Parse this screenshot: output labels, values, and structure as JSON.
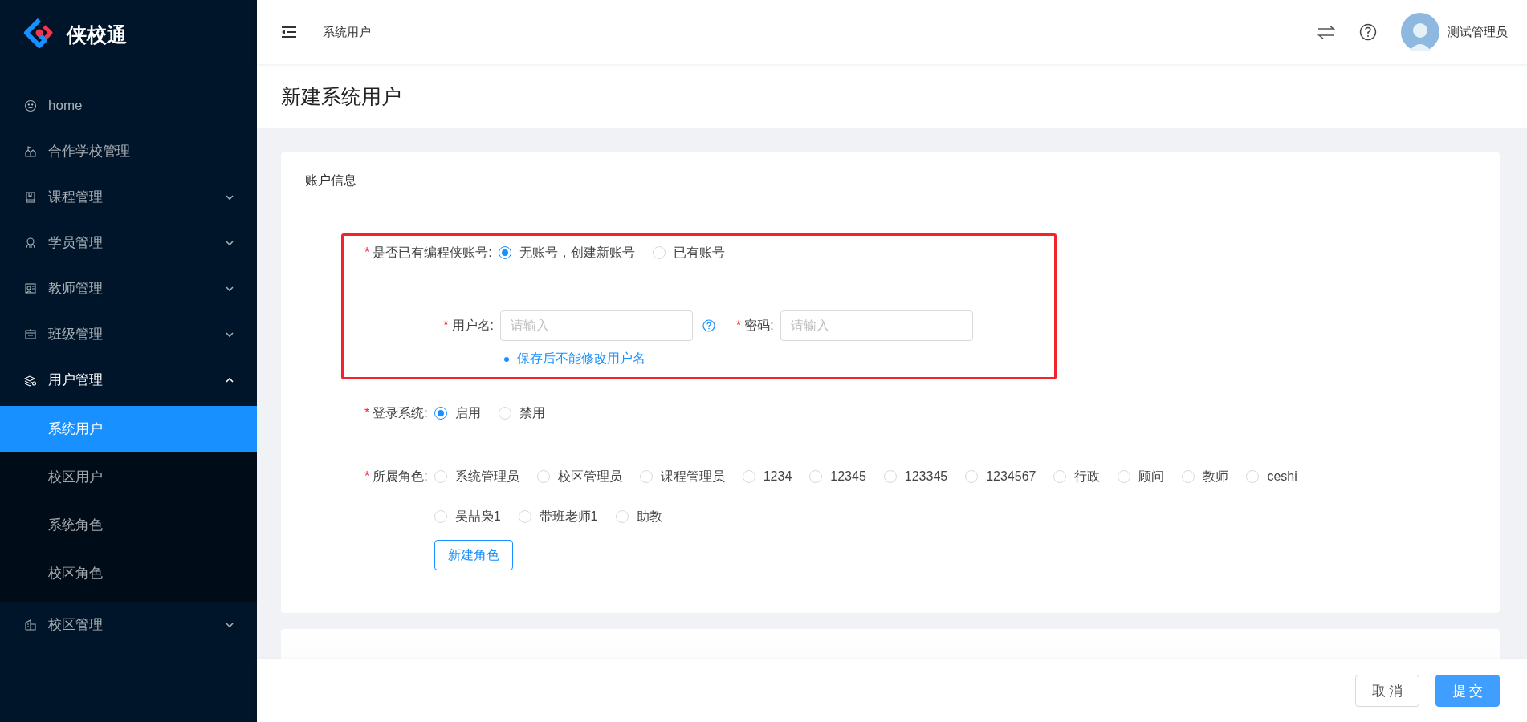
{
  "brand": {
    "name": "侠校通"
  },
  "sidebar": {
    "items": [
      {
        "label": "home"
      },
      {
        "label": "合作学校管理"
      },
      {
        "label": "课程管理",
        "expanded": false
      },
      {
        "label": "学员管理",
        "expanded": false
      },
      {
        "label": "教师管理",
        "expanded": false
      },
      {
        "label": "班级管理",
        "expanded": false
      },
      {
        "label": "用户管理",
        "expanded": true,
        "children": [
          {
            "label": "系统用户",
            "selected": true
          },
          {
            "label": "校区用户",
            "selected": false
          },
          {
            "label": "系统角色",
            "selected": false
          },
          {
            "label": "校区角色",
            "selected": false
          }
        ]
      },
      {
        "label": "校区管理",
        "expanded": false
      }
    ]
  },
  "header": {
    "breadcrumb": "系统用户",
    "user_name": "测试管理员"
  },
  "page_title": "新建系统用户",
  "sections": [
    {
      "title": "账户信息",
      "groups": [
        {
          "highlighted": true,
          "rows": [
            {
              "kind": "radio",
              "label": "是否已有编程侠账号:",
              "required_mark": "*",
              "options": [
                {
                  "label": "无账号，创建新账号",
                  "selected": true
                },
                {
                  "label": "已有账号",
                  "selected": false
                }
              ]
            },
            {
              "kind": "inputs",
              "fields": [
                {
                  "label": "用户名:",
                  "required_mark": "*",
                  "placeholder": "请输入",
                  "help": true
                },
                {
                  "label": "密码:",
                  "required_mark": "*",
                  "placeholder": "请输入",
                  "help": false
                }
              ],
              "hint": "保存后不能修改用户名"
            }
          ]
        },
        {
          "highlighted": false,
          "rows": [
            {
              "kind": "radio",
              "label": "登录系统:",
              "required_mark": "*",
              "options": [
                {
                  "label": "启用",
                  "selected": true
                },
                {
                  "label": "禁用",
                  "selected": false
                }
              ]
            },
            {
              "kind": "radio",
              "label": "所属角色:",
              "required_mark": "*",
              "options": [
                {
                  "label": "系统管理员",
                  "selected": false
                },
                {
                  "label": "校区管理员",
                  "selected": false
                },
                {
                  "label": "课程管理员",
                  "selected": false
                },
                {
                  "label": "1234",
                  "selected": false
                },
                {
                  "label": "12345",
                  "selected": false
                },
                {
                  "label": "123345",
                  "selected": false
                },
                {
                  "label": "1234567",
                  "selected": false
                },
                {
                  "label": "行政",
                  "selected": false
                },
                {
                  "label": "顾问",
                  "selected": false
                },
                {
                  "label": "教师",
                  "selected": false
                },
                {
                  "label": "ceshi",
                  "selected": false
                },
                {
                  "label": "吴喆枭1",
                  "selected": false
                },
                {
                  "label": "带班老师1",
                  "selected": false
                },
                {
                  "label": "助教",
                  "selected": false
                }
              ],
              "button": "新建角色"
            }
          ]
        }
      ]
    }
  ],
  "footer": {
    "buttons": [
      {
        "label": "取 消",
        "kind": "default"
      },
      {
        "label": "提 交",
        "kind": "primary"
      }
    ]
  }
}
